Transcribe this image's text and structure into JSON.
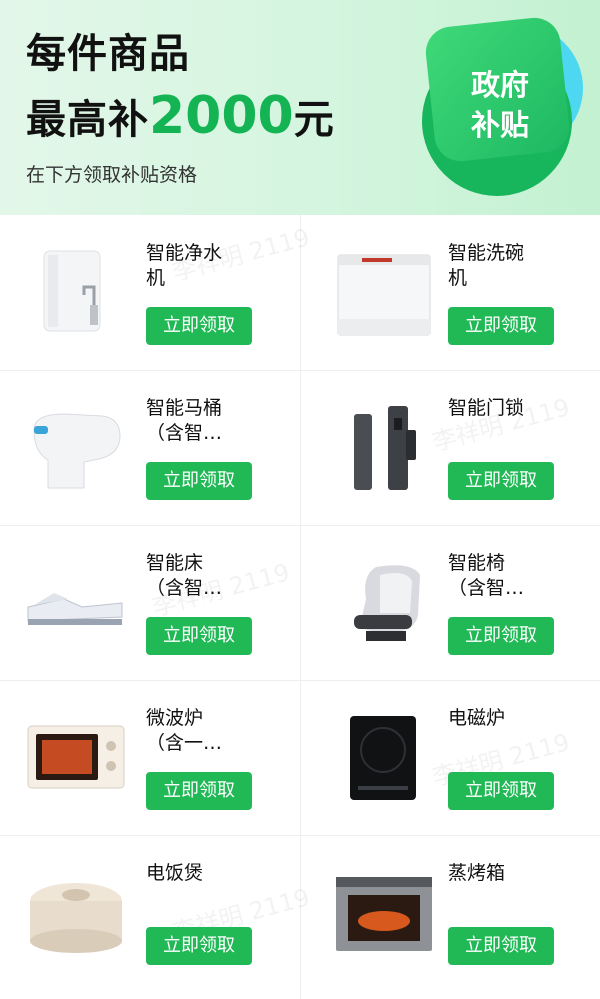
{
  "banner": {
    "line1": "每件商品",
    "line2_prefix": "最高补",
    "line2_amount": "2000",
    "line2_suffix": "元",
    "subline": "在下方领取补贴资格",
    "badge_line1": "政府",
    "badge_line2": "补贴"
  },
  "watermark": "李祥明 2119",
  "products": [
    {
      "name_l1": "智能净水",
      "name_l2": "机",
      "button": "立即领取",
      "icon": "water-purifier-icon"
    },
    {
      "name_l1": "智能洗碗",
      "name_l2": "机",
      "button": "立即领取",
      "icon": "dishwasher-icon"
    },
    {
      "name_l1": "智能马桶",
      "name_l2": "（含智…",
      "button": "立即领取",
      "icon": "smart-toilet-icon"
    },
    {
      "name_l1": "智能门锁",
      "name_l2": "",
      "button": "立即领取",
      "icon": "door-lock-icon"
    },
    {
      "name_l1": "智能床",
      "name_l2": "（含智…",
      "button": "立即领取",
      "icon": "smart-bed-icon"
    },
    {
      "name_l1": "智能椅",
      "name_l2": "（含智…",
      "button": "立即领取",
      "icon": "massage-chair-icon"
    },
    {
      "name_l1": "微波炉",
      "name_l2": "（含一…",
      "button": "立即领取",
      "icon": "microwave-icon"
    },
    {
      "name_l1": "电磁炉",
      "name_l2": "",
      "button": "立即领取",
      "icon": "induction-cooker-icon"
    },
    {
      "name_l1": "电饭煲",
      "name_l2": "",
      "button": "立即领取",
      "icon": "rice-cooker-icon"
    },
    {
      "name_l1": "蒸烤箱",
      "name_l2": "",
      "button": "立即领取",
      "icon": "steam-oven-icon"
    }
  ],
  "colors": {
    "accent": "#21b856",
    "amount": "#14b353",
    "banner_bg": "#d4f5df"
  }
}
